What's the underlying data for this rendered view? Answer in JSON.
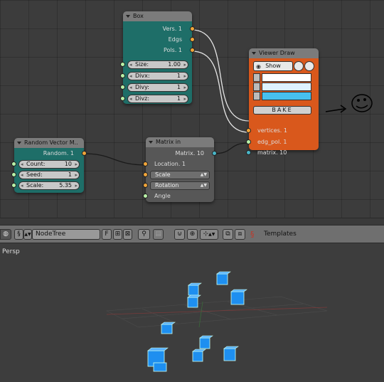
{
  "nodes": {
    "box": {
      "title": "Box",
      "outputs": [
        "Vers. 1",
        "Edgs",
        "Pols. 1"
      ],
      "inputs": [
        {
          "label": "Size:",
          "value": "1.00"
        },
        {
          "label": "Divx:",
          "value": "1"
        },
        {
          "label": "Divy:",
          "value": "1"
        },
        {
          "label": "Divz:",
          "value": "1"
        }
      ]
    },
    "random_vector": {
      "title": "Random Vector M..",
      "output": "Random. 1",
      "inputs": [
        {
          "label": "Count:",
          "value": "10"
        },
        {
          "label": "Seed:",
          "value": "1"
        },
        {
          "label": "Scale:",
          "value": "5.35"
        }
      ]
    },
    "matrix_in": {
      "title": "Matrix in",
      "output": "Matrix. 10",
      "location": "Location. 1",
      "scale": "Scale",
      "rotation": "Rotation",
      "angle": "Angle"
    },
    "viewer_draw": {
      "title": "Viewer Draw",
      "show_label": "Show",
      "swatches": [
        "#ffffff",
        "#dff2ff",
        "#47c0ee"
      ],
      "bake_label": "BAKE",
      "inputs": [
        "vertices. 1",
        "edg_pol. 1",
        "matrix. 10"
      ]
    }
  },
  "header": {
    "tree_name": "NodeTree",
    "f_label": "F",
    "templates_label": "Templates"
  },
  "viewport": {
    "view_label": "Persp"
  },
  "colors": {
    "node_teal": "#1e6e68",
    "node_orange": "#d9581c",
    "cube_blue": "#1e8ff0",
    "socket_orange": "#f0a53a",
    "socket_green": "#b9f2a8",
    "socket_teal": "#49b6c8"
  }
}
